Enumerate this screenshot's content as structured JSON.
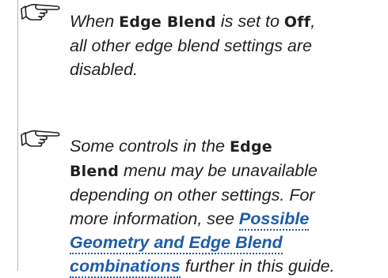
{
  "notes": [
    {
      "icon": "pointing-hand-icon",
      "line1_pre": "When ",
      "line1_term": "Edge Blend",
      "line1_mid": " is set to ",
      "line1_term2": "Off",
      "line1_post": ",",
      "line2": "all other edge blend settings are",
      "line3": "disabled."
    },
    {
      "icon": "pointing-hand-icon",
      "line1_pre": "Some controls in the ",
      "line1_term": "Edge",
      "line2_term": "Blend",
      "line2_post": " menu may be unavailable",
      "line3": "depending on other settings. For",
      "line4_pre": "more information, see ",
      "link_part1": "Possible",
      "link_part2": "Geometry and Edge Blend",
      "link_part3": "combinations",
      "line6_post": " further in this guide."
    }
  ],
  "colors": {
    "text": "#231f20",
    "link": "#1f5ca8",
    "rule": "#b8b8b8"
  }
}
